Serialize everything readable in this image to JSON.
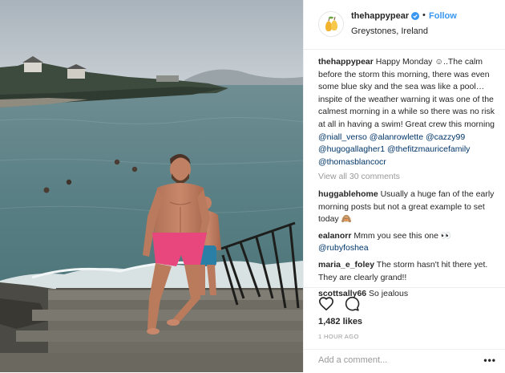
{
  "post": {
    "username": "thehappypear",
    "follow_label": "Follow",
    "dot": "•",
    "location": "Greystones, Ireland",
    "caption": {
      "username": "thehappypear",
      "text": "Happy Monday ☺..The calm before the storm this morning, there was even some blue sky and the sea was like a pool… inspite of the weather warning it was one of the calmest morning in a while so there was no risk at all in having a swim! Great crew this morning ",
      "mentions": [
        "@niall_verso",
        "@alanrowlette",
        "@cazzy99",
        "@hugogallagher1",
        "@thefitzmauricefamily",
        "@thomasblancocr"
      ]
    },
    "view_all": "View all 30 comments",
    "comments": [
      {
        "username": "huggablehome",
        "text": "Usually a huge fan of the early morning posts but not a great example to set today 🙈",
        "mention": ""
      },
      {
        "username": "ealanorr",
        "text": "Mmm you see this one 👀 ",
        "mention": "@rubyfoshea"
      },
      {
        "username": "maria_e_foley",
        "text": "The storm hasn't hit there yet. They are clearly grand!!",
        "mention": ""
      },
      {
        "username": "scottsally66",
        "text": "So jealous",
        "mention": ""
      }
    ],
    "likes": "1,482 likes",
    "time": "1 HOUR AGO",
    "add_comment_placeholder": "Add a comment...",
    "more_label": "•••"
  },
  "colors": {
    "link": "#3897f0",
    "mention": "#003569",
    "muted": "#999999",
    "text": "#262626",
    "verified": "#3897f0"
  },
  "icons": [
    "verified-badge-icon",
    "heart-icon",
    "comment-bubble-icon",
    "pears-logo-icon",
    "more-options-icon"
  ]
}
